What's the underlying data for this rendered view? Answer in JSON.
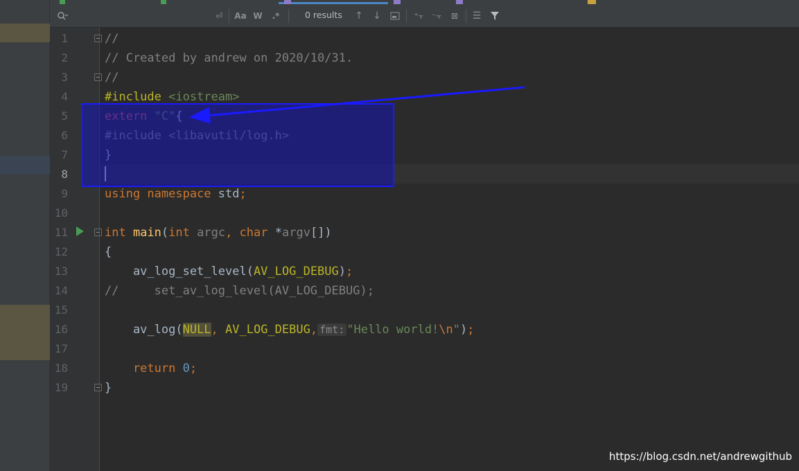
{
  "find_toolbar": {
    "search_placeholder": "",
    "results_text": "0 results",
    "match_case_label": "Aa",
    "words_label": "W",
    "regex_label": ".*"
  },
  "editor": {
    "lines": [
      {
        "num": "1",
        "tokens": [
          {
            "c": "c-comment",
            "t": "//"
          }
        ]
      },
      {
        "num": "2",
        "tokens": [
          {
            "c": "c-comment",
            "t": "// Created by andrew on 2020/10/31."
          }
        ]
      },
      {
        "num": "3",
        "tokens": [
          {
            "c": "c-comment",
            "t": "//"
          }
        ]
      },
      {
        "num": "4",
        "tokens": [
          {
            "c": "c-macro",
            "t": "#include "
          },
          {
            "c": "c-str",
            "t": "<iostream>"
          }
        ]
      },
      {
        "num": "5",
        "tokens": [
          {
            "c": "c-ext",
            "t": "extern "
          },
          {
            "c": "c-str",
            "t": "\"C\""
          },
          {
            "c": "c-plain",
            "t": "{"
          }
        ]
      },
      {
        "num": "6",
        "tokens": [
          {
            "c": "c-comment",
            "t": "#include <libavutil/log.h>"
          }
        ]
      },
      {
        "num": "7",
        "tokens": [
          {
            "c": "c-plain",
            "t": "}"
          }
        ]
      },
      {
        "num": "8",
        "tokens": []
      },
      {
        "num": "9",
        "tokens": [
          {
            "c": "c-kw",
            "t": "using namespace "
          },
          {
            "c": "c-plain",
            "t": "std"
          },
          {
            "c": "c-kw",
            "t": ";"
          }
        ]
      },
      {
        "num": "10",
        "tokens": []
      },
      {
        "num": "11",
        "tokens": [
          {
            "c": "c-kw",
            "t": "int "
          },
          {
            "c": "c-func",
            "t": "main"
          },
          {
            "c": "c-plain",
            "t": "("
          },
          {
            "c": "c-kw",
            "t": "int "
          },
          {
            "c": "c-comment",
            "t": "argc"
          },
          {
            "c": "c-kw",
            "t": ", "
          },
          {
            "c": "c-kw",
            "t": "char "
          },
          {
            "c": "c-plain",
            "t": "*"
          },
          {
            "c": "c-comment",
            "t": "argv"
          },
          {
            "c": "c-plain",
            "t": "[])"
          }
        ]
      },
      {
        "num": "12",
        "tokens": [
          {
            "c": "c-plain",
            "t": "{"
          }
        ]
      },
      {
        "num": "13",
        "tokens": [
          {
            "c": "c-plain",
            "t": "    av_log_set_level("
          },
          {
            "c": "c-enum",
            "t": "AV_LOG_DEBUG"
          },
          {
            "c": "c-plain",
            "t": ")"
          },
          {
            "c": "c-kw",
            "t": ";"
          }
        ]
      },
      {
        "num": "14",
        "tokens": [
          {
            "c": "c-comment",
            "t": "//     set_av_log_level(AV_LOG_DEBUG);"
          }
        ]
      },
      {
        "num": "15",
        "tokens": []
      },
      {
        "num": "16",
        "tokens": [
          {
            "c": "c-plain",
            "t": "    av_log("
          },
          {
            "c": "c-enum null-hl",
            "t": "NULL"
          },
          {
            "c": "c-kw",
            "t": ", "
          },
          {
            "c": "c-enum",
            "t": "AV_LOG_DEBUG"
          },
          {
            "c": "c-kw",
            "t": ","
          },
          {
            "c": "hint",
            "t": "fmt:"
          },
          {
            "c": "c-str",
            "t": "\"Hello world!"
          },
          {
            "c": "c-kw",
            "t": "\\n"
          },
          {
            "c": "c-str",
            "t": "\""
          },
          {
            "c": "c-plain",
            "t": ")"
          },
          {
            "c": "c-kw",
            "t": ";"
          }
        ]
      },
      {
        "num": "17",
        "tokens": []
      },
      {
        "num": "18",
        "tokens": [
          {
            "c": "c-kw",
            "t": "    return "
          },
          {
            "c": "c-num",
            "t": "0"
          },
          {
            "c": "c-kw",
            "t": ";"
          }
        ]
      },
      {
        "num": "19",
        "tokens": [
          {
            "c": "c-plain",
            "t": "}"
          }
        ]
      }
    ]
  },
  "watermark": "https://blog.csdn.net/andrewgithub",
  "colors": {
    "editor_bg": "#2b2b2b",
    "annotation_box": "#1a1aff",
    "annotation_arrow": "#1a1aff"
  }
}
